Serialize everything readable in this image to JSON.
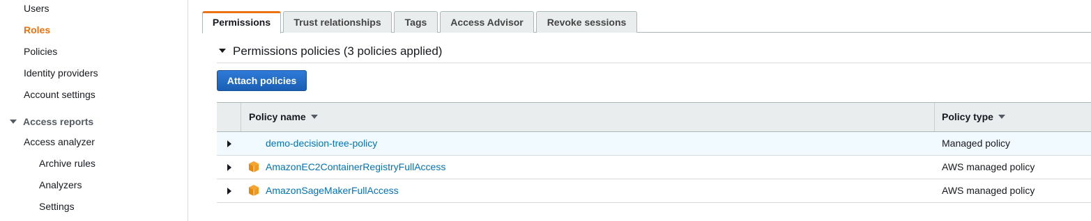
{
  "sidebar": {
    "items": [
      {
        "label": "Users"
      },
      {
        "label": "Roles"
      },
      {
        "label": "Policies"
      },
      {
        "label": "Identity providers"
      },
      {
        "label": "Account settings"
      }
    ],
    "access_reports": {
      "title": "Access reports",
      "items": [
        {
          "label": "Access analyzer"
        },
        {
          "label": "Archive rules"
        },
        {
          "label": "Analyzers"
        },
        {
          "label": "Settings"
        }
      ]
    }
  },
  "tabs": [
    {
      "label": "Permissions"
    },
    {
      "label": "Trust relationships"
    },
    {
      "label": "Tags"
    },
    {
      "label": "Access Advisor"
    },
    {
      "label": "Revoke sessions"
    }
  ],
  "permissions": {
    "header": "Permissions policies (3 policies applied)",
    "attach_button": "Attach policies",
    "columns": {
      "name": "Policy name",
      "type": "Policy type"
    },
    "rows": [
      {
        "name": "demo-decision-tree-policy",
        "type": "Managed policy",
        "icon": "none"
      },
      {
        "name": "AmazonEC2ContainerRegistryFullAccess",
        "type": "AWS managed policy",
        "icon": "aws-cube-icon"
      },
      {
        "name": "AmazonSageMakerFullAccess",
        "type": "AWS managed policy",
        "icon": "aws-cube-icon"
      }
    ]
  },
  "colors": {
    "accent": "#ec7211",
    "link": "#0073bb",
    "button": "#1a5fb4"
  }
}
